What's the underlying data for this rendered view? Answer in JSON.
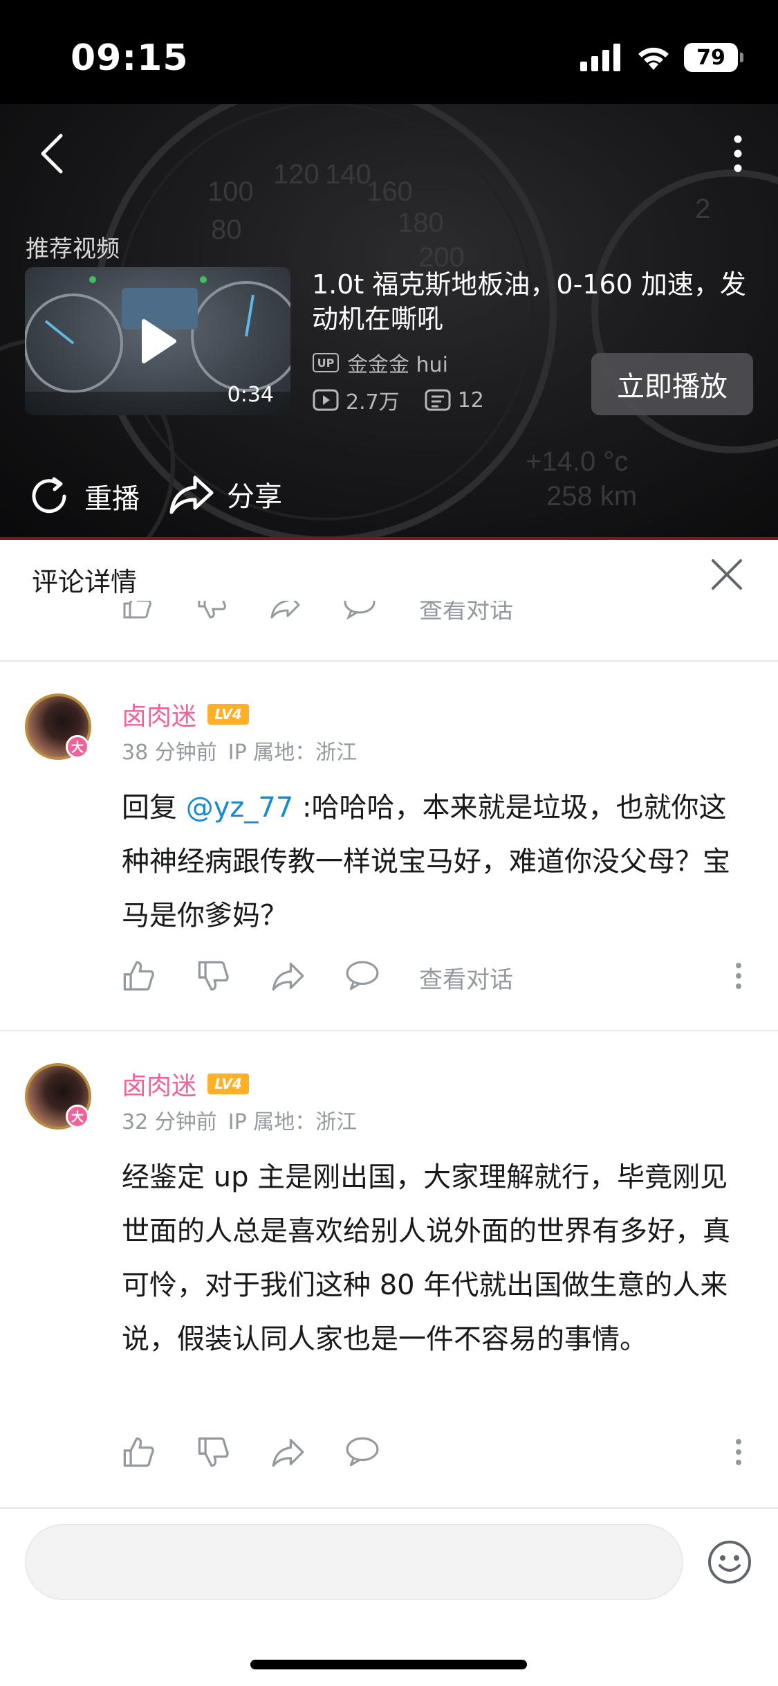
{
  "status_bar": {
    "time": "09:15",
    "battery": "79"
  },
  "video": {
    "recommend_label": "推荐视频",
    "recommended": {
      "title": "1.0t 福克斯地板油，0-160 加速，发动机在嘶吼",
      "duration": "0:34",
      "uploader_badge": "UP",
      "uploader": "金金金 hui",
      "views": "2.7万",
      "danmaku": "12",
      "play_now_label": "立即播放"
    },
    "replay_label": "重播",
    "share_label": "分享"
  },
  "comments_panel": {
    "title": "评论详情",
    "partial_view_conversation": "查看对话",
    "comments": [
      {
        "username": "卤肉迷",
        "level": "LV4",
        "avatar_badge": "大",
        "time": "38 分钟前",
        "ip": "IP 属地：浙江",
        "reply_prefix": "回复 ",
        "mention": "@yz_77",
        "text": " :哈哈哈，本来就是垃圾，也就你这种神经病跟传教一样说宝马好，难道你没父母？宝马是你爹妈？",
        "view_conversation": "查看对话"
      },
      {
        "username": "卤肉迷",
        "level": "LV4",
        "avatar_badge": "大",
        "time": "32 分钟前",
        "ip": "IP 属地：浙江",
        "text": "经鉴定 up 主是刚出国，大家理解就行，毕竟刚见世面的人总是喜欢给别人说外面的世界有多好，真可怜，对于我们这种 80 年代就出国做生意的人来说，假装认同人家也是一件不容易的事情。"
      }
    ]
  },
  "icons": {
    "back": "back-arrow-icon",
    "more": "more-vertical-icon",
    "play": "play-icon",
    "replay": "replay-icon",
    "share": "share-icon",
    "close": "close-icon",
    "like": "thumbs-up-icon",
    "dislike": "thumbs-down-icon",
    "forward": "forward-icon",
    "reply": "reply-bubble-icon",
    "emoji": "emoji-icon"
  },
  "colors": {
    "username": "#f0639a",
    "mention": "#178bcf",
    "level_badge": "#ffb027",
    "meta": "#9499a0"
  }
}
